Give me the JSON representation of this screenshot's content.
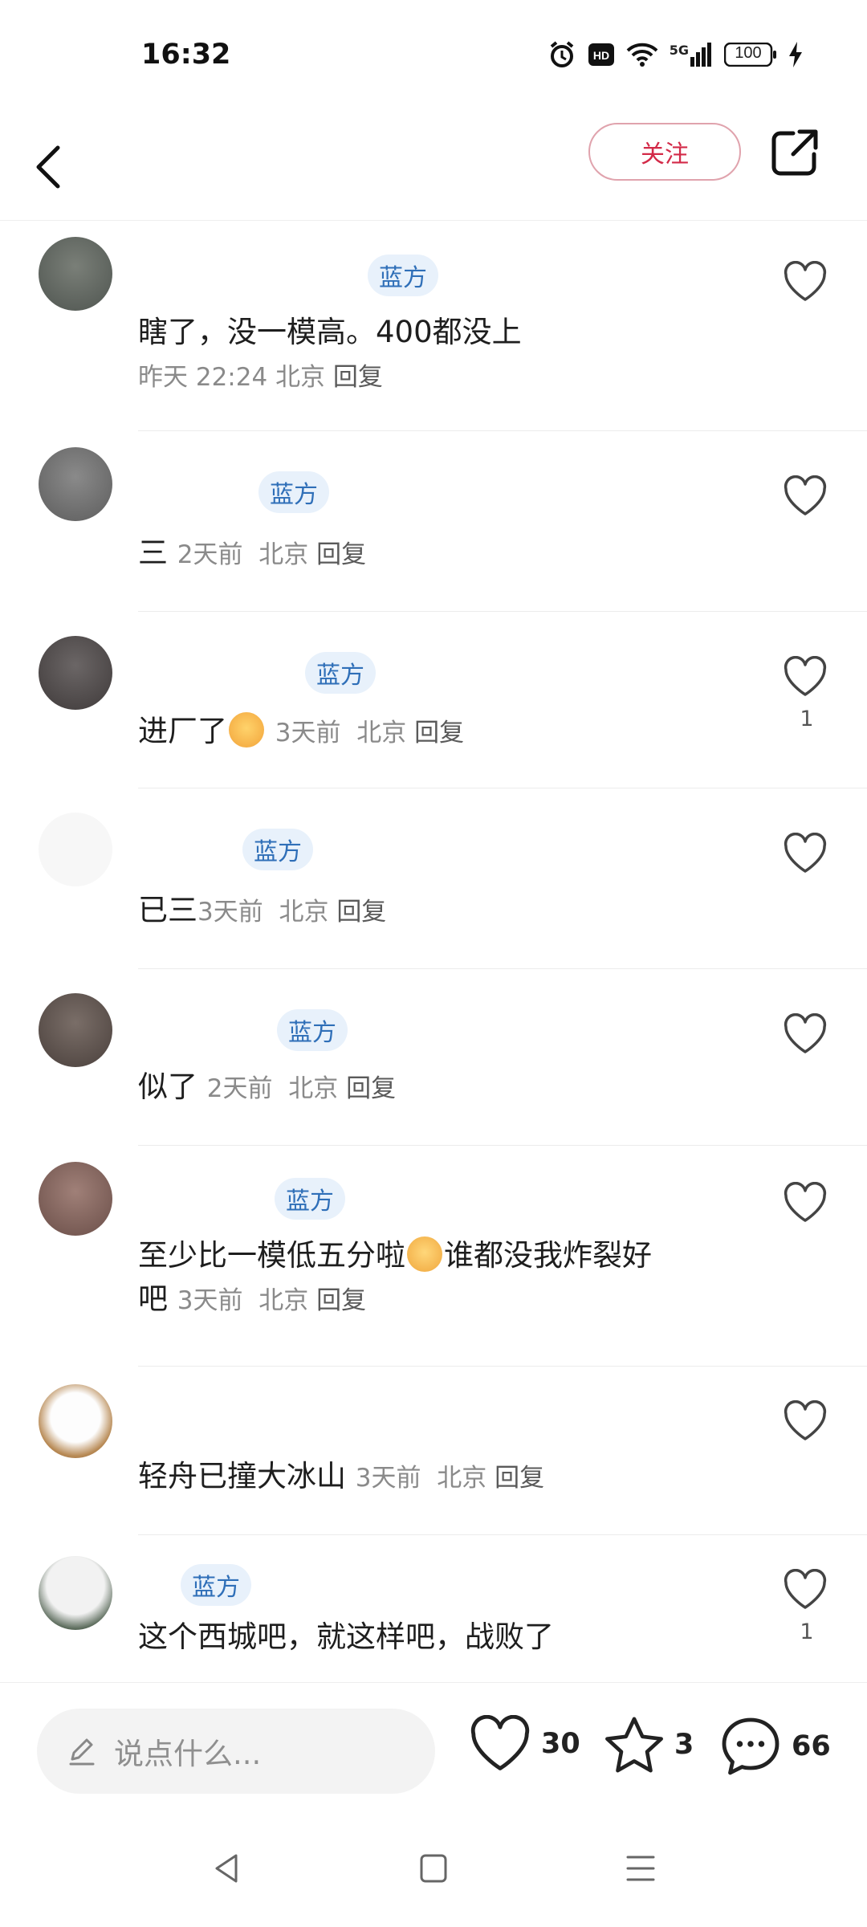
{
  "status_bar": {
    "time": "16:32",
    "battery": "100",
    "network": "5G",
    "hd": "HD",
    "icons": [
      "alarm-icon",
      "hd-icon",
      "wifi-icon",
      "5g-signal-icon",
      "battery-icon",
      "charging-icon"
    ]
  },
  "header": {
    "follow_label": "关注",
    "icons": [
      "back-arrow-icon",
      "share-icon"
    ]
  },
  "comments": [
    {
      "tag": "蓝方",
      "text": "瞎了，没一模高。400都没上",
      "time": "昨天 22:24",
      "location": "北京",
      "reply": "回复",
      "likes": ""
    },
    {
      "tag": "蓝方",
      "text": "三",
      "time": "2天前",
      "location": "北京",
      "reply": "回复",
      "likes": ""
    },
    {
      "tag": "蓝方",
      "text": "进厂了",
      "time": "3天前",
      "location": "北京",
      "reply": "回复",
      "likes": "1",
      "emoji": "sun-emoji-icon"
    },
    {
      "tag": "蓝方",
      "text": "已三",
      "time": "3天前",
      "location": "北京",
      "reply": "回复",
      "likes": ""
    },
    {
      "tag": "蓝方",
      "text": "似了",
      "time": "2天前",
      "location": "北京",
      "reply": "回复",
      "likes": ""
    },
    {
      "tag": "蓝方",
      "text_part1": "至少比一模低五分啦",
      "text_part2": "谁都没我炸裂好",
      "text_part3": "吧",
      "time": "3天前",
      "location": "北京",
      "reply": "回复",
      "likes": "",
      "emoji": "shocked-emoji-icon"
    },
    {
      "tag": "",
      "text": "轻舟已撞大冰山",
      "time": "3天前",
      "location": "北京",
      "reply": "回复",
      "likes": ""
    },
    {
      "tag": "蓝方",
      "text": "这个西城吧，就这样吧，战败了",
      "likes": "1"
    }
  ],
  "bottom_bar": {
    "input_placeholder": "说点什么...",
    "like_count": "30",
    "star_count": "3",
    "comment_count": "66"
  },
  "nav_bar": {
    "icons": [
      "back-triangle-icon",
      "home-square-icon",
      "menu-lines-icon"
    ]
  },
  "colors": {
    "accent_red": "#d32a48",
    "tag_blue": "#2f6fb8",
    "tag_bg": "#e8f1fb"
  }
}
